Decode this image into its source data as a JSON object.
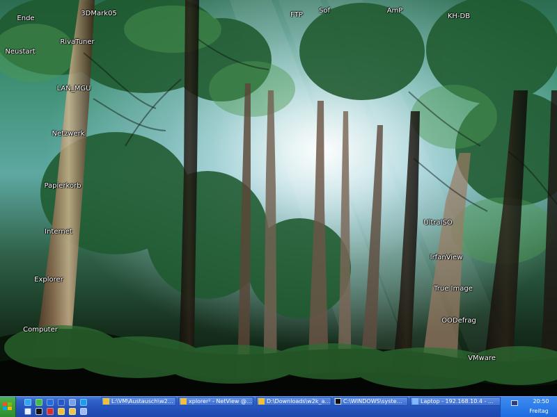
{
  "desktop": {
    "icons": [
      {
        "label": "Ende",
        "icon": "shutdown-icon"
      },
      {
        "label": "3DMark05",
        "icon": "benchmark-icon"
      },
      {
        "label": "FTP",
        "icon": "ftp-icon"
      },
      {
        "label": "Sof",
        "icon": "software-icon"
      },
      {
        "label": "AmP",
        "icon": "amp-icon"
      },
      {
        "label": "KH-DB",
        "icon": "database-icon"
      },
      {
        "label": "RivaTuner",
        "icon": "rivatuner-icon"
      },
      {
        "label": "Neustart",
        "icon": "restart-icon"
      },
      {
        "label": "LAN_MGU",
        "icon": "network-shortcut-icon"
      },
      {
        "label": "Netzwerk",
        "icon": "network-icon"
      },
      {
        "label": "Papierkorb",
        "icon": "recycle-bin-icon"
      },
      {
        "label": "Internet",
        "icon": "internet-icon"
      },
      {
        "label": "Explorer",
        "icon": "explorer-icon"
      },
      {
        "label": "Computer",
        "icon": "computer-icon"
      },
      {
        "label": "UltraISO",
        "icon": "ultraiso-icon"
      },
      {
        "label": "IrfanView",
        "icon": "irfanview-icon"
      },
      {
        "label": "True Image",
        "icon": "true-image-icon"
      },
      {
        "label": "OODefrag",
        "icon": "oodefrag-icon"
      },
      {
        "label": "VMware",
        "icon": "vmware-icon"
      }
    ]
  },
  "taskbar": {
    "start_icon": "windows-logo-icon",
    "quick_launch": [
      {
        "icon": "globe-icon",
        "color": "#32a4f0"
      },
      {
        "icon": "green-circle-icon",
        "color": "#44b948"
      },
      {
        "icon": "blue-square-icon",
        "color": "#276bd7"
      },
      {
        "icon": "m-app-icon",
        "color": "#2457c2"
      },
      {
        "icon": "window-app-icon",
        "color": "#7aa0e8"
      },
      {
        "icon": "picture-app-icon",
        "color": "#1e9ee8"
      },
      {
        "icon": "settings-icon",
        "color": "#e7f0ff"
      },
      {
        "icon": "terminal-icon",
        "color": "#111111"
      },
      {
        "icon": "flag-icon",
        "color": "#d32d2d"
      },
      {
        "icon": "folder-icon",
        "color": "#f0c038"
      },
      {
        "icon": "star-icon",
        "color": "#eec54f"
      },
      {
        "icon": "utility-icon",
        "color": "#9fbaf2"
      }
    ],
    "tasks": [
      {
        "label": "L:\\VM\\Austausch\\w2k_...",
        "icon": "folder-icon",
        "icon_color": "#f0c038"
      },
      {
        "label": "xplorer² - NetView @ ...",
        "icon": "xplorer-icon",
        "icon_color": "#f1be3d"
      },
      {
        "label": "D:\\Downloads\\w2k_ad...",
        "icon": "folder-icon",
        "icon_color": "#f0c038"
      },
      {
        "label": "C:\\WINDOWS\\system3...",
        "icon": "command-prompt-icon",
        "icon_color": "#111111"
      },
      {
        "label": "Laptop - 192.168.10.4 - ...",
        "icon": "remote-desktop-icon",
        "icon_color": "#80b7ff"
      }
    ],
    "tray": {
      "icon": "network-monitor-icon",
      "time": "20:50",
      "day": "Freitag"
    }
  }
}
